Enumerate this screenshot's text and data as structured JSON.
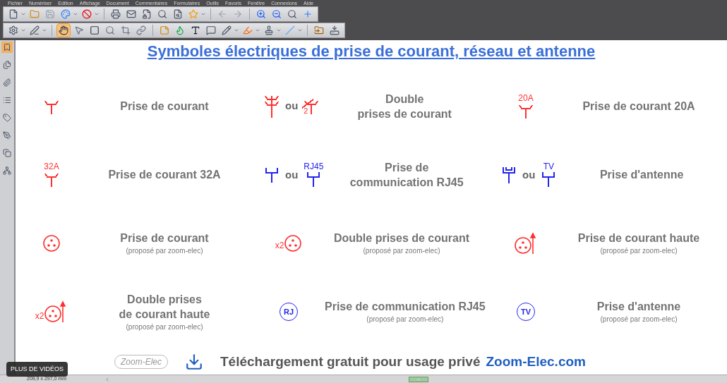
{
  "menu": [
    "Fichier",
    "Numériser",
    "Edition",
    "Affichage",
    "Document",
    "Commentaires",
    "Formulaires",
    "Outils",
    "Favoris",
    "Fenêtre",
    "Connexions",
    "Aide"
  ],
  "toolbars": [
    [
      {
        "kind": "new",
        "dropdown": true,
        "selected": false
      },
      {
        "kind": "open",
        "dropdown": false,
        "selected": false
      },
      {
        "kind": "save",
        "dropdown": false,
        "selected": false
      },
      {
        "kind": "convert",
        "dropdown": true,
        "selected": false
      },
      {
        "kind": "pdf",
        "dropdown": true,
        "selected": false
      },
      {
        "kind": "separator"
      },
      {
        "kind": "print",
        "dropdown": false,
        "selected": false
      },
      {
        "kind": "mail",
        "dropdown": false,
        "selected": false
      },
      {
        "kind": "secure",
        "dropdown": false,
        "selected": false
      },
      {
        "kind": "search",
        "dropdown": false,
        "selected": false
      },
      {
        "kind": "find",
        "dropdown": false,
        "selected": false
      },
      {
        "kind": "favorite",
        "dropdown": true,
        "selected": false
      },
      {
        "kind": "separator"
      },
      {
        "kind": "back",
        "dropdown": false,
        "selected": false
      },
      {
        "kind": "forward",
        "dropdown": false,
        "selected": false
      },
      {
        "kind": "separator"
      },
      {
        "kind": "zoom-in",
        "dropdown": false,
        "selected": false
      },
      {
        "kind": "zoom-out",
        "dropdown": false,
        "selected": false
      },
      {
        "kind": "zoom",
        "dropdown": false,
        "selected": false
      },
      {
        "kind": "fit",
        "dropdown": false,
        "selected": false
      }
    ],
    [
      {
        "kind": "settings",
        "dropdown": true,
        "selected": false
      },
      {
        "kind": "edit",
        "dropdown": true,
        "selected": false
      },
      {
        "kind": "separator"
      },
      {
        "kind": "hand",
        "dropdown": false,
        "selected": true
      },
      {
        "kind": "pointer",
        "dropdown": false,
        "selected": false
      },
      {
        "kind": "select",
        "dropdown": false,
        "selected": false
      },
      {
        "kind": "magnify",
        "dropdown": false,
        "selected": false
      },
      {
        "kind": "crop",
        "dropdown": false,
        "selected": false
      },
      {
        "kind": "link",
        "dropdown": false,
        "selected": false
      },
      {
        "kind": "separator"
      },
      {
        "kind": "note",
        "dropdown": false,
        "selected": false
      },
      {
        "kind": "flame",
        "dropdown": false,
        "selected": false
      },
      {
        "kind": "text",
        "dropdown": false,
        "selected": false
      },
      {
        "kind": "callout",
        "dropdown": false,
        "selected": false
      },
      {
        "kind": "pencil",
        "dropdown": true,
        "selected": false
      },
      {
        "kind": "highlight",
        "dropdown": true,
        "selected": false
      },
      {
        "kind": "stamp",
        "dropdown": true,
        "selected": false
      },
      {
        "kind": "line",
        "dropdown": true,
        "selected": false
      },
      {
        "kind": "separator"
      },
      {
        "kind": "import",
        "dropdown": false,
        "selected": false
      },
      {
        "kind": "export",
        "dropdown": false,
        "selected": false
      }
    ]
  ],
  "sidebar": [
    {
      "kind": "bookmark",
      "selected": true
    },
    {
      "kind": "pages",
      "selected": false
    },
    {
      "kind": "attachments",
      "selected": false
    },
    {
      "kind": "layers",
      "selected": false
    },
    {
      "kind": "tags",
      "selected": false
    },
    {
      "kind": "signatures",
      "selected": false
    },
    {
      "kind": "copy",
      "selected": false
    },
    {
      "kind": "network",
      "selected": false
    }
  ],
  "document": {
    "title": "Symboles électriques de prise de courant, réseau et antenne",
    "rows": [
      [
        {
          "symbols": [
            {
              "kind": "outlet"
            }
          ],
          "label": [
            "Prise de courant"
          ],
          "color": "#ff3030"
        },
        {
          "symbols": [
            {
              "kind": "double-outlet"
            },
            {
              "kind": "outlet-slashed",
              "tag": "2"
            }
          ],
          "joiner": "ou",
          "label": [
            "Double",
            "prises de courant"
          ],
          "color": "#ff3030"
        },
        {
          "symbols": [
            {
              "kind": "outlet",
              "tag": "20A"
            }
          ],
          "label": [
            "Prise de courant 20A"
          ],
          "color": "#ff3030"
        }
      ],
      [
        {
          "symbols": [
            {
              "kind": "outlet",
              "tag": "32A"
            }
          ],
          "label": [
            "Prise de courant 32A"
          ],
          "color": "#ff3030"
        },
        {
          "symbols": [
            {
              "kind": "data"
            },
            {
              "kind": "data",
              "tag": "RJ45"
            }
          ],
          "joiner": "ou",
          "label": [
            "Prise de",
            "communication RJ45"
          ],
          "color": "#2323ee"
        },
        {
          "symbols": [
            {
              "kind": "antenna"
            },
            {
              "kind": "data",
              "tag": "TV"
            }
          ],
          "joiner": "ou",
          "label": [
            "Prise d'antenne"
          ],
          "color": "#2323ee"
        }
      ],
      [
        {
          "symbols": [
            {
              "kind": "socket"
            }
          ],
          "label": [
            "Prise de courant"
          ],
          "note": "(proposé par zoom-elec)",
          "color": "#ff3030"
        },
        {
          "symbols": [
            {
              "kind": "socket",
              "prefix": "x2"
            }
          ],
          "label": [
            "Double prises de courant"
          ],
          "note": "(proposé par zoom-elec)",
          "color": "#ff3030"
        },
        {
          "symbols": [
            {
              "kind": "socket-high"
            }
          ],
          "label": [
            "Prise de courant haute"
          ],
          "note": "(proposé par zoom-elec)",
          "color": "#ff3030"
        }
      ],
      [
        {
          "symbols": [
            {
              "kind": "socket-high",
              "prefix": "x2"
            }
          ],
          "label": [
            "Double prises",
            "de courant haute"
          ],
          "note": "(proposé par zoom-elec)",
          "color": "#ff3030"
        },
        {
          "symbols": [
            {
              "kind": "badge",
              "tag": "RJ"
            }
          ],
          "label": [
            "Prise de communication RJ45"
          ],
          "note": "(proposé par zoom-elec)",
          "color": "#2323ee"
        },
        {
          "symbols": [
            {
              "kind": "badge",
              "tag": "TV"
            }
          ],
          "label": [
            "Prise d'antenne"
          ],
          "note": "(proposé par zoom-elec)",
          "color": "#2323ee"
        }
      ]
    ],
    "footer": {
      "logo": "Zoom-Elec",
      "text": "Téléchargement gratuit pour usage privé",
      "link": "Zoom-Elec.com"
    }
  },
  "video_button": "PLUS DE VIDÉOS",
  "status": {
    "page_size": "209,9 x 297,0 mm"
  }
}
